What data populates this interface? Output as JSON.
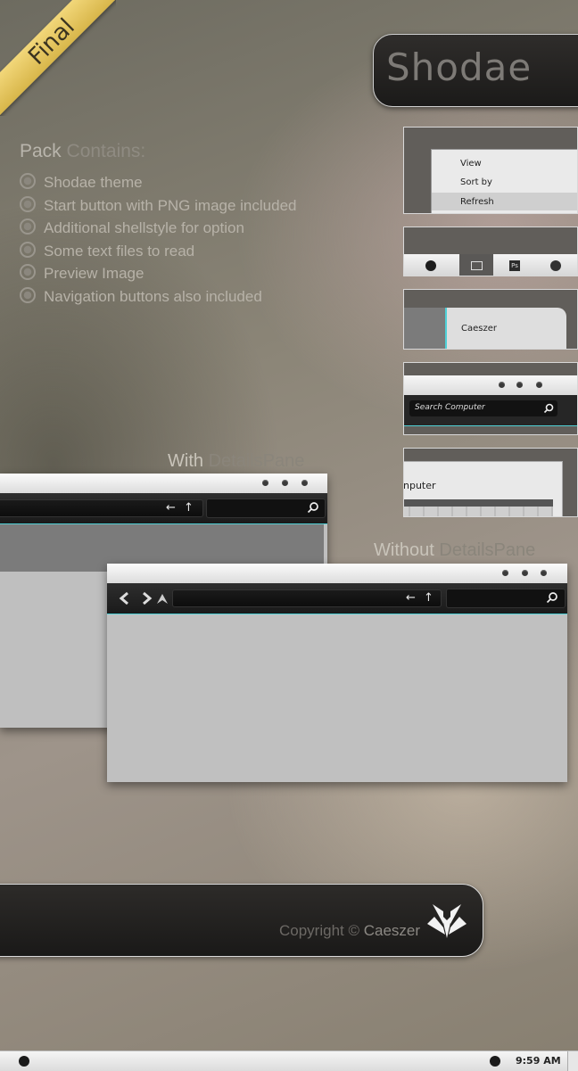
{
  "ribbon": {
    "label": "Final",
    "color": "#e4c55e"
  },
  "brand": {
    "title": "Shodae"
  },
  "pack": {
    "title_a": "Pack",
    "title_b": "Contains:",
    "items": [
      "Shodae theme",
      "Start button with PNG image included",
      "Additional shellstyle for option",
      "Some text files to read",
      "Preview Image",
      "Navigation buttons also included"
    ]
  },
  "thumbs": {
    "context_menu": {
      "items": [
        "View",
        "Sort by",
        "Refresh"
      ]
    },
    "taskbar": {
      "ps_label": "Ps"
    },
    "details": {
      "name": "Caeszer"
    },
    "search": {
      "placeholder": "Search Computer"
    },
    "preview": {
      "title_fragment": "nputer"
    }
  },
  "captions": {
    "with_a": "With",
    "with_b": "DetailsPane",
    "without_a": "Without",
    "without_b": "DetailsPane"
  },
  "footer": {
    "copyright_a": "Copyright ©",
    "copyright_b": "Caeszer"
  },
  "taskbar": {
    "clock": "9:59 AM"
  },
  "colors": {
    "accent": "#4fd0d6",
    "dark": "#1b1a19",
    "pane": "#c0c0c0"
  },
  "icons": [
    "bullet-ring-icon",
    "back-icon",
    "forward-icon",
    "up-icon",
    "search-icon",
    "start-orb-icon",
    "logo-icon"
  ]
}
